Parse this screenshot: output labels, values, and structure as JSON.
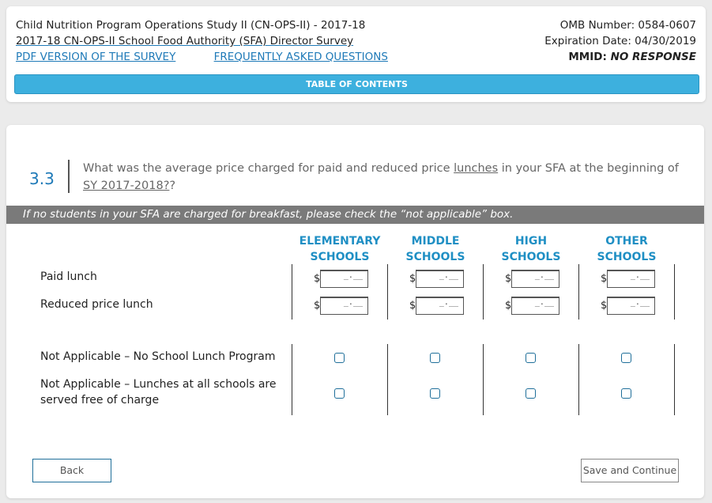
{
  "header": {
    "study_title": "Child Nutrition Program Operations Study II (CN-OPS-II) - 2017-18",
    "survey_title": "2017-18 CN-OPS-II School Food Authority (SFA) Director Survey",
    "pdf_link": "PDF VERSION OF THE SURVEY",
    "faq_link": "FREQUENTLY ASKED QUESTIONS",
    "omb_number": "OMB Number: 0584-0607",
    "expiration": "Expiration Date: 04/30/2019",
    "mmid_label": "MMID: ",
    "mmid_value": "NO RESPONSE",
    "toc_label": "TABLE OF CONTENTS"
  },
  "question": {
    "number": "3.3",
    "text_before": "What was the average price charged for paid and reduced price ",
    "term_lunches": "lunches",
    "text_middle": " in your SFA at the beginning of ",
    "term_sy": "SY 2017-2018?",
    "text_after": "?"
  },
  "instruction": "If no students in your SFA are charged for breakfast, please check the “not applicable” box.",
  "columns": [
    {
      "line1": "ELEMENTARY",
      "line2": "SCHOOLS"
    },
    {
      "line1": "MIDDLE",
      "line2": "SCHOOLS"
    },
    {
      "line1": "HIGH",
      "line2": "SCHOOLS"
    },
    {
      "line1": "OTHER",
      "line2": "SCHOOLS"
    }
  ],
  "price_rows": [
    {
      "label": "Paid lunch"
    },
    {
      "label": "Reduced price lunch"
    }
  ],
  "na_rows": [
    {
      "label": "Not Applicable – No School Lunch Program"
    },
    {
      "label_line1": "Not Applicable – Lunches at all schools are",
      "label_line2": "served free of charge"
    }
  ],
  "currency_symbol": "$",
  "input_mask": "_.__",
  "buttons": {
    "back": "Back",
    "save": "Save and Continue"
  },
  "colors": {
    "accent": "#3db0de",
    "link": "#1f7ab8",
    "column_header": "#1f8fc4",
    "instruction_bar": "#7a7a7a"
  }
}
